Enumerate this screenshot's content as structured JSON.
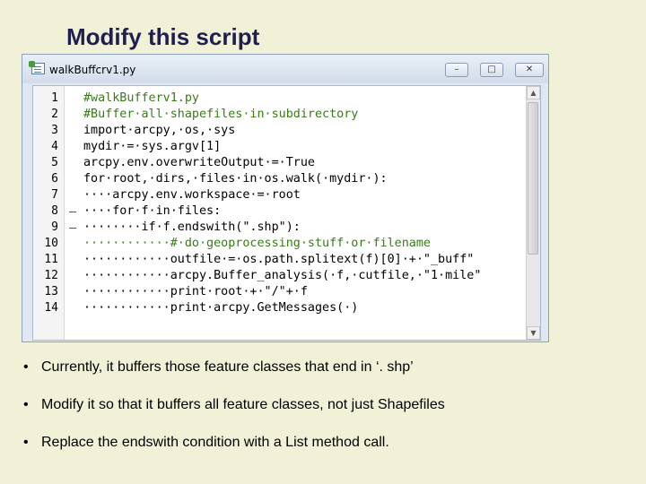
{
  "slide": {
    "title": "Modify this script"
  },
  "window": {
    "title": "walkBuffcrv1.py",
    "min_glyph": "–",
    "max_glyph": "□",
    "close_glyph": "✕"
  },
  "editor": {
    "lines": [
      {
        "n": "1",
        "code": "#walkBufferv1.py",
        "color": "#3a7a1a"
      },
      {
        "n": "2",
        "code": "#Buffer·all·shapefiles·in·subdirectory",
        "color": "#3a7a1a"
      },
      {
        "n": "3",
        "code": "import·arcpy,·os,·sys",
        "color": "#000000"
      },
      {
        "n": "4",
        "code": "mydir·=·sys.argv[1]",
        "color": "#000000"
      },
      {
        "n": "5",
        "code": "arcpy.env.overwriteOutput·=·True",
        "color": "#000000"
      },
      {
        "n": "6",
        "code": "for·root,·dirs,·files·in·os.walk(·mydir·):",
        "color": "#000000"
      },
      {
        "n": "7",
        "code": "····arcpy.env.workspace·=·root",
        "color": "#000000"
      },
      {
        "n": "8",
        "code": "····for·f·in·files:",
        "color": "#000000"
      },
      {
        "n": "9",
        "code": "········if·f.endswith(\".shp\"):",
        "color": "#000000"
      },
      {
        "n": "10",
        "code": "············#·do·geoprocessing·stuff·or·filename",
        "color": "#3a7a1a"
      },
      {
        "n": "11",
        "code": "············outfile·=·os.path.splitext(f)[0]·+·\"_buff\"",
        "color": "#000000"
      },
      {
        "n": "12",
        "code": "············arcpy.Buffer_analysis(·f,·cutfile,·\"1·mile\"",
        "color": "#000000"
      },
      {
        "n": "13",
        "code": "············print·root·+·\"/\"+·f",
        "color": "#000000"
      },
      {
        "n": "14",
        "code": "············print·arcpy.GetMessages(·)",
        "color": "#000000"
      }
    ]
  },
  "bullets": [
    {
      "dot": "•",
      "text": "Currently, it buffers those feature classes that end in ‘. shp’"
    },
    {
      "dot": "•",
      "text": "Modify it so that it buffers all feature classes, not just Shapefiles"
    },
    {
      "dot": "•",
      "text": "Replace the endswith condition with a List method call."
    }
  ]
}
